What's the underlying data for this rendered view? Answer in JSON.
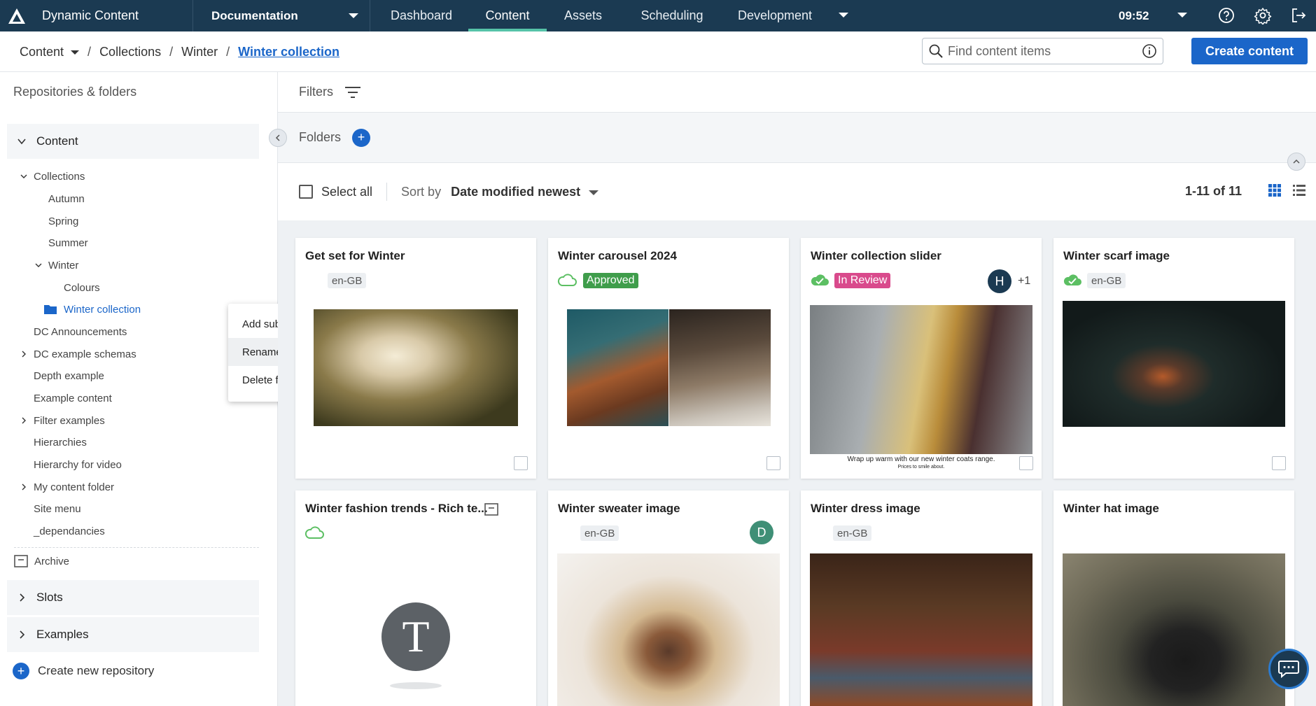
{
  "app": {
    "title": "Dynamic Content",
    "hub": "Documentation"
  },
  "nav": {
    "tabs": [
      "Dashboard",
      "Content",
      "Assets",
      "Scheduling",
      "Development"
    ],
    "active_tab": "Content",
    "time": "09:52",
    "icons": [
      "help-icon",
      "gear-icon",
      "logout-icon"
    ]
  },
  "breadcrumb": {
    "root": "Content",
    "items": [
      "Collections",
      "Winter"
    ],
    "current": "Winter collection"
  },
  "search": {
    "placeholder": "Find content items",
    "value": ""
  },
  "create_button": "Create content",
  "sidebar": {
    "heading": "Repositories & folders",
    "content_section": "Content",
    "tree": {
      "collections": "Collections",
      "autumn": "Autumn",
      "spring": "Spring",
      "summer": "Summer",
      "winter": "Winter",
      "colours": "Colours",
      "winter_collection": "Winter collection",
      "dc_announcements": "DC Announcements",
      "dc_example_schemas": "DC example schemas",
      "depth_example": "Depth example",
      "example_content": "Example content",
      "filter_examples": "Filter examples",
      "hierarchies": "Hierarchies",
      "hierarchy_video": "Hierarchy for video",
      "my_content_folder": "My content folder",
      "site_menu": "Site menu",
      "dependancies": "_dependancies"
    },
    "archive": "Archive",
    "slots": "Slots",
    "examples": "Examples",
    "create_repo": "Create new repository"
  },
  "context_menu": [
    "Add subfolder",
    "Rename",
    "Delete folder"
  ],
  "main": {
    "filters": "Filters",
    "folders": "Folders",
    "select_all": "Select all",
    "sort_label": "Sort by",
    "sort_value": "Date modified newest",
    "count": "1-11 of 11"
  },
  "cards": [
    {
      "title": "Get set for Winter",
      "locale": "en-GB"
    },
    {
      "title": "Winter carousel 2024",
      "status": "Approved"
    },
    {
      "title": "Winter collection slider",
      "status": "In Review",
      "avatar": "H",
      "extra": "+1",
      "caption": "Wrap up warm with our new winter coats range.",
      "caption_sub": "Prices to smile about."
    },
    {
      "title": "Winter scarf image",
      "locale": "en-GB"
    },
    {
      "title": "Winter fashion trends - Rich te...",
      "avatar": "T"
    },
    {
      "title": "Winter sweater image",
      "locale": "en-GB",
      "avatar": "D"
    },
    {
      "title": "Winter dress image",
      "locale": "en-GB"
    },
    {
      "title": "Winter hat image"
    }
  ],
  "colors": {
    "nav_bg": "#1b3a52",
    "accent": "#1b66c9",
    "active_tab_underline": "#56c3a8",
    "approved": "#3f9d4b",
    "in_review": "#d94a8c",
    "cloud_green": "#5cbf63"
  }
}
